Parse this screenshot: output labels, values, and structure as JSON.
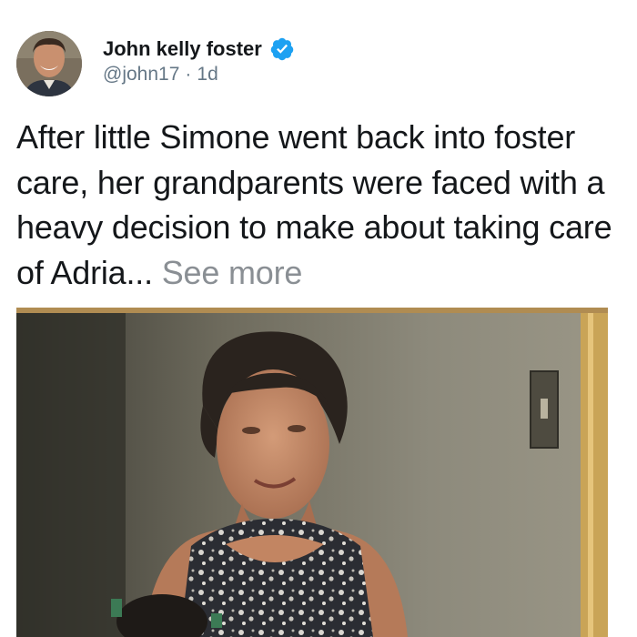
{
  "tweet": {
    "author_name": "John kelly foster",
    "handle": "@john17",
    "separator": "·",
    "time": "1d",
    "text": "After little Simone went back into foster care, her grandparents were faced with a heavy decision to make about taking care of Adria... ",
    "see_more": "See more",
    "verified_icon": "verified-badge-icon",
    "accent_color": "#1da1f2"
  },
  "media": {
    "type": "photo",
    "subject": "elderly woman in floral sleeveless top"
  }
}
